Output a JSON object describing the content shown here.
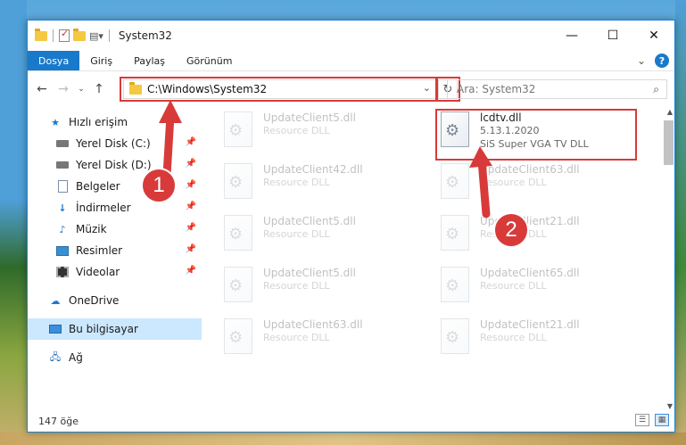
{
  "window": {
    "title": "System32",
    "controls": {
      "minimize": "—",
      "maximize": "☐",
      "close": "✕"
    }
  },
  "ribbon": {
    "tabs": [
      {
        "label": "Dosya",
        "active": true
      },
      {
        "label": "Giriş"
      },
      {
        "label": "Paylaş"
      },
      {
        "label": "Görünüm"
      }
    ],
    "help": "?",
    "expand": "⌄"
  },
  "address": {
    "path": "C:\\Windows\\System32",
    "search_placeholder": "Ara: System32"
  },
  "sidebar": {
    "quick_access": "Hızlı erişim",
    "items": [
      {
        "label": "Yerel Disk (C:)",
        "icon": "disk-icon"
      },
      {
        "label": "Yerel Disk (D:)",
        "icon": "disk-icon"
      },
      {
        "label": "Belgeler",
        "icon": "document-icon"
      },
      {
        "label": "İndirmeler",
        "icon": "download-icon"
      },
      {
        "label": "Müzik",
        "icon": "music-icon"
      },
      {
        "label": "Resimler",
        "icon": "pictures-icon"
      },
      {
        "label": "Videolar",
        "icon": "videos-icon"
      }
    ],
    "onedrive": "OneDrive",
    "this_pc": "Bu bilgisayar",
    "network": "Ağ"
  },
  "files": [
    {
      "name": "UpdateClient5.dll",
      "desc": "Resource DLL"
    },
    {
      "name": "lcdtv.dll",
      "version": "5.13.1.2020",
      "desc": "SiS Super VGA TV DLL",
      "highlighted": true
    },
    {
      "name": "UpdateClient42.dll",
      "desc": "Resource DLL"
    },
    {
      "name": "UpdateClient63.dll",
      "desc": "Resource DLL"
    },
    {
      "name": "UpdateClient5.dll",
      "desc": "Resource DLL"
    },
    {
      "name": "UpdateClient21.dll",
      "desc": "Resource DLL"
    },
    {
      "name": "UpdateClient5.dll",
      "desc": "Resource DLL"
    },
    {
      "name": "UpdateClient65.dll",
      "desc": "Resource DLL"
    },
    {
      "name": "UpdateClient63.dll",
      "desc": "Resource DLL"
    },
    {
      "name": "UpdateClient21.dll",
      "desc": "Resource DLL"
    }
  ],
  "status": {
    "count": "147 öğe"
  },
  "callouts": {
    "one": "1",
    "two": "2"
  },
  "colors": {
    "accent": "#1979ca",
    "highlight_red": "#d83a3a",
    "selected_nav": "#cce8ff"
  }
}
